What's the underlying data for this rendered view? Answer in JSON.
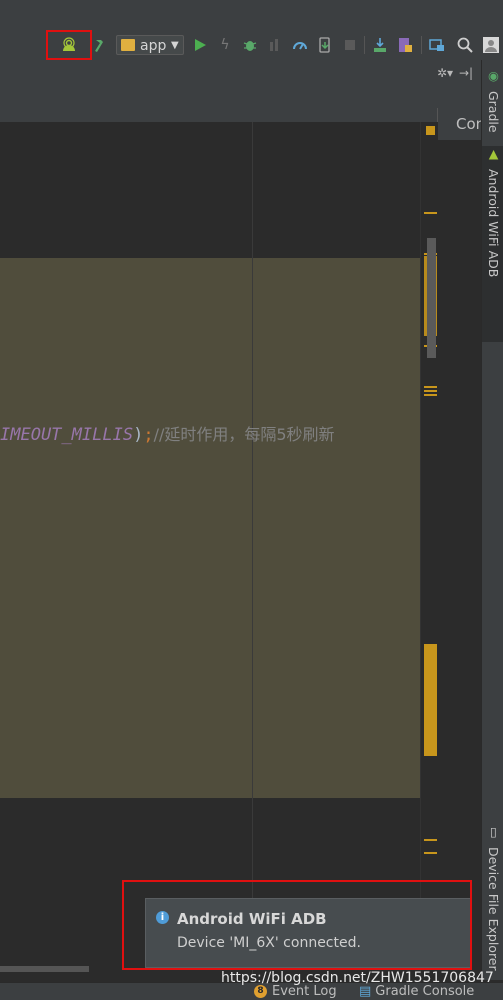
{
  "toolbar": {
    "run_config": "app",
    "icons": [
      "wifi-adb-android-icon",
      "build-hammer-icon",
      "run-icon",
      "apply-changes-icon",
      "debug-icon",
      "attach-debugger-icon",
      "profiler-icon",
      "device-manager-icon",
      "stop-icon",
      "sdk-download-icon",
      "avd-manager-icon",
      "project-structure-icon",
      "search-icon",
      "avatar-icon"
    ]
  },
  "right_panel": {
    "console_tab": "Con"
  },
  "editor": {
    "code_line": {
      "constant": "IMEOUT_MILLIS",
      "punct": ")",
      "semicolon": ";",
      "comment": "//延时作用，每隔5秒刷新"
    }
  },
  "sidebar": {
    "tabs": [
      {
        "label": "Gradle",
        "icon": "gradle-icon"
      },
      {
        "label": "Android WiFi ADB",
        "icon": "android-wifi-icon"
      },
      {
        "label": "Device File Explorer",
        "icon": "device-icon"
      }
    ]
  },
  "notification": {
    "title": "Android WiFi ADB",
    "message": "Device 'MI_6X' connected."
  },
  "statusbar": {
    "event_log_count": "8",
    "event_log": "Event Log",
    "gradle_console": "Gradle Console"
  },
  "watermark": "https://blog.csdn.net/ZHW1551706847",
  "colors": {
    "highlight_red": "#e01010",
    "editor_bg": "#2b2b2b",
    "selection_bg": "#504d3c",
    "marker": "#c8961c"
  }
}
